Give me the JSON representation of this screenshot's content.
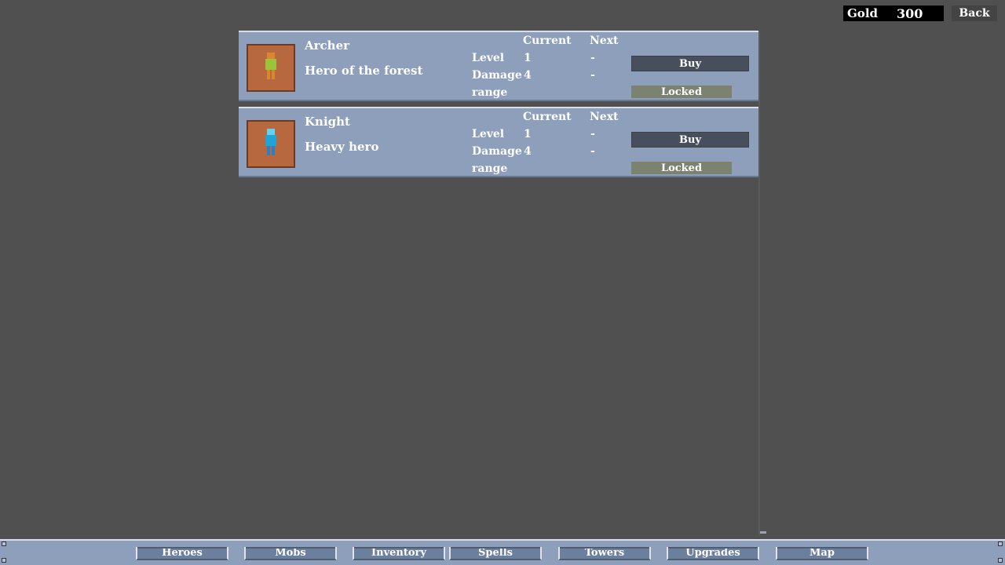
{
  "header": {
    "gold_label": "Gold",
    "gold_value": "300",
    "back_label": "Back"
  },
  "heroes": [
    {
      "name": "Archer",
      "description": "Hero of the forest",
      "body_color": "#9ac43a",
      "head_color": "#d9862c",
      "leg_color": "#d9862c",
      "col_current": "Current",
      "col_next": "Next",
      "stats": [
        {
          "label": "Level",
          "current": "1",
          "next": "-"
        },
        {
          "label": "Damage",
          "current": "4",
          "next": "-"
        },
        {
          "label": "range",
          "current": "",
          "next": ""
        }
      ],
      "buy_label": "Buy",
      "status_label": "Locked"
    },
    {
      "name": "Knight",
      "description": "Heavy hero",
      "body_color": "#22a3d6",
      "head_color": "#5fd3ef",
      "leg_color": "#2a7fc9",
      "col_current": "Current",
      "col_next": "Next",
      "stats": [
        {
          "label": "Level",
          "current": "1",
          "next": "-"
        },
        {
          "label": "Damage",
          "current": "4",
          "next": "-"
        },
        {
          "label": "range",
          "current": "",
          "next": ""
        }
      ],
      "buy_label": "Buy",
      "status_label": "Locked"
    }
  ],
  "nav": {
    "tabs": [
      {
        "label": "Heroes"
      },
      {
        "label": "Mobs"
      },
      {
        "label": "Inventory"
      },
      {
        "label": "Spells"
      },
      {
        "label": "Towers"
      },
      {
        "label": "Upgrades"
      },
      {
        "label": "Map"
      }
    ]
  },
  "colors": {
    "background": "#505050",
    "panel": "#8d9fbb",
    "portrait": "#b8683f",
    "buy_button": "#474f5c",
    "locked_badge": "#7c8270",
    "gold_box": "#000000"
  }
}
